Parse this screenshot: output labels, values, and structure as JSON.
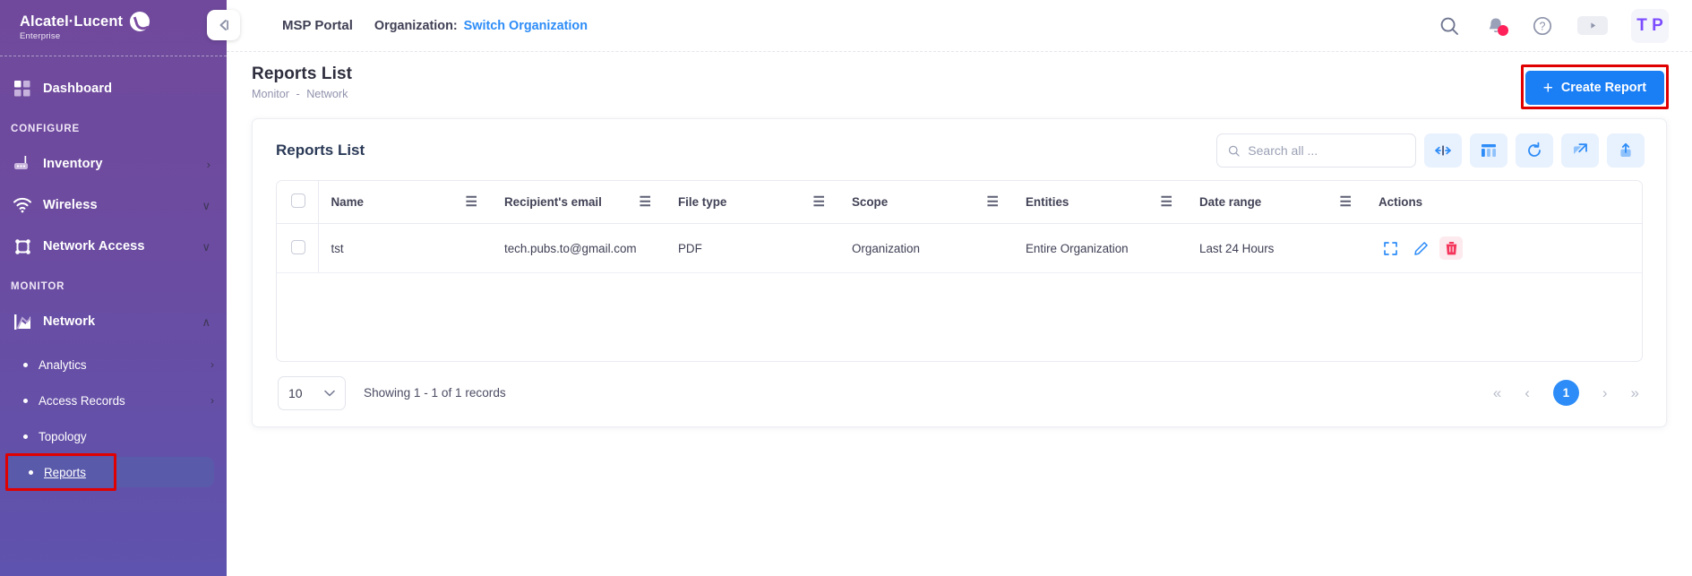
{
  "brand": {
    "name": "Alcatel·Lucent",
    "sub": "Enterprise",
    "logo_icon": "alcatel-lucent-logo-icon"
  },
  "sidebar": {
    "collapse_icon": "collapse-left-icon",
    "top_items": [
      {
        "label": "Dashboard",
        "icon": "dashboard-grid-icon",
        "chevron": ""
      }
    ],
    "sections": [
      {
        "title": "CONFIGURE",
        "items": [
          {
            "label": "Inventory",
            "icon": "router-icon",
            "chevron": "›"
          },
          {
            "label": "Wireless",
            "icon": "wifi-icon",
            "chevron": "∨"
          },
          {
            "label": "Network Access",
            "icon": "network-access-icon",
            "chevron": "∨"
          }
        ]
      },
      {
        "title": "MONITOR",
        "items": [
          {
            "label": "Network",
            "icon": "chart-area-icon",
            "chevron": "∧"
          }
        ],
        "sub_items": [
          {
            "label": "Analytics",
            "chevron": "›",
            "active": false
          },
          {
            "label": "Access Records",
            "chevron": "›",
            "active": false
          },
          {
            "label": "Topology",
            "chevron": "",
            "active": false
          },
          {
            "label": "Reports",
            "chevron": "",
            "active": true
          }
        ]
      }
    ]
  },
  "topbar": {
    "msp_portal": "MSP Portal",
    "organization_label": "Organization:",
    "switch_organization": "Switch Organization",
    "icons": {
      "search": "search-icon",
      "notifications": "bell-icon",
      "help": "question-circle-icon",
      "play": "play-icon"
    },
    "avatar_initials": "T P"
  },
  "page": {
    "title": "Reports List",
    "breadcrumb": {
      "root": "Monitor",
      "separator": "-",
      "leaf": "Network"
    },
    "create_button": {
      "label": "Create Report",
      "plus": "+"
    }
  },
  "card": {
    "title": "Reports List",
    "search": {
      "placeholder": "Search all ...",
      "value": "",
      "icon": "search-icon"
    },
    "tools": [
      {
        "name": "fit-columns-button",
        "icon": "fit-columns-icon"
      },
      {
        "name": "column-settings-button",
        "icon": "column-settings-icon"
      },
      {
        "name": "refresh-button",
        "icon": "refresh-icon"
      },
      {
        "name": "open-external-button",
        "icon": "external-link-icon"
      },
      {
        "name": "export-button",
        "icon": "upload-export-icon"
      }
    ]
  },
  "table": {
    "select_all": false,
    "columns": [
      {
        "label": "Name",
        "menu": true
      },
      {
        "label": "Recipient's email",
        "menu": true
      },
      {
        "label": "File type",
        "menu": true
      },
      {
        "label": "Scope",
        "menu": true
      },
      {
        "label": "Entities",
        "menu": true
      },
      {
        "label": "Date range",
        "menu": true
      },
      {
        "label": "Actions",
        "menu": false
      }
    ],
    "rows": [
      {
        "selected": false,
        "name": "tst",
        "recipient_email": "tech.pubs.to@gmail.com",
        "file_type": "PDF",
        "scope": "Organization",
        "entities": "Entire Organization",
        "date_range": "Last 24 Hours",
        "actions": [
          {
            "name": "expand-row-button",
            "icon": "expand-icon"
          },
          {
            "name": "edit-row-button",
            "icon": "pencil-icon"
          },
          {
            "name": "delete-row-button",
            "icon": "trash-icon"
          }
        ]
      }
    ]
  },
  "pagination": {
    "page_size": "10",
    "page_size_chevron": "∨",
    "showing": "Showing 1 - 1 of 1 records",
    "first": "«",
    "prev": "‹",
    "current_page": "1",
    "next": "›",
    "last": "»"
  },
  "colors": {
    "sidebar_top": "#70499c",
    "sidebar_bottom": "#5e53ae",
    "accent_blue": "#1a7ef5",
    "link_blue": "#2d8cf7",
    "highlight_red": "#e00000",
    "danger_red": "#f5365c",
    "active_item": "#5a5aab"
  }
}
